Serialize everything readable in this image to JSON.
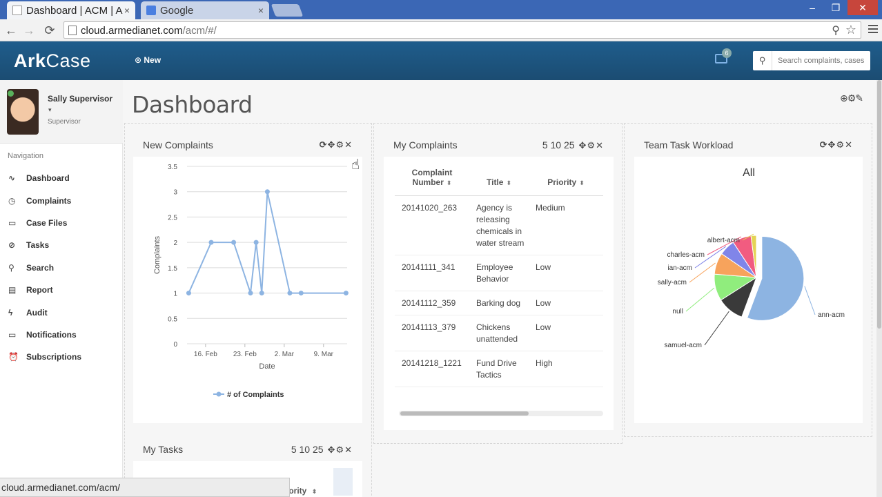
{
  "browser": {
    "tabs": [
      {
        "label": "Dashboard | ACM | A",
        "close": "×",
        "active": true
      },
      {
        "label": "Google",
        "close": "×",
        "active": false
      }
    ],
    "url_main": "cloud.armedianet.com",
    "url_path": "/acm/#/",
    "status_url": "cloud.armedianet.com/acm/",
    "window_controls": {
      "minimize": "–",
      "maximize": "❐",
      "close": "✕"
    }
  },
  "header": {
    "logo_a": "Ark",
    "logo_b": "Case",
    "new_label": "New",
    "notification_count": "6",
    "search_placeholder": "Search complaints, cases"
  },
  "user": {
    "name": "Sally Supervisor",
    "role": "Supervisor",
    "caret": "▾"
  },
  "navigation": {
    "header": "Navigation",
    "items": [
      {
        "icon": "chart-line-icon",
        "glyph": "∿",
        "label": "Dashboard"
      },
      {
        "icon": "clock-icon",
        "glyph": "◷",
        "label": "Complaints"
      },
      {
        "icon": "folder-icon",
        "glyph": "▭",
        "label": "Case Files"
      },
      {
        "icon": "check-circle-icon",
        "glyph": "⊘",
        "label": "Tasks"
      },
      {
        "icon": "search-icon",
        "glyph": "⚲",
        "label": "Search"
      },
      {
        "icon": "bar-chart-icon",
        "glyph": "▤",
        "label": "Report"
      },
      {
        "icon": "bolt-icon",
        "glyph": "ϟ",
        "label": "Audit"
      },
      {
        "icon": "comment-icon",
        "glyph": "▭",
        "label": "Notifications"
      },
      {
        "icon": "alarm-icon",
        "glyph": "⏰",
        "label": "Subscriptions"
      }
    ]
  },
  "page": {
    "title": "Dashboard",
    "tools": "⊕⚙✎"
  },
  "widgets": {
    "new_complaints": {
      "title": "New Complaints",
      "tools": "⟳✥⚙✕"
    },
    "my_complaints": {
      "title": "My Complaints",
      "pager": "5 10 25",
      "tools": "✥⚙✕",
      "columns": [
        "Complaint Number",
        "Title",
        "Priority"
      ],
      "rows": [
        {
          "number": "20141020_263",
          "title": "Agency is releasing chemicals in water stream",
          "priority": "Medium"
        },
        {
          "number": "20141111_341",
          "title": "Employee Behavior",
          "priority": "Low"
        },
        {
          "number": "20141112_359",
          "title": "Barking dog",
          "priority": "Low"
        },
        {
          "number": "20141113_379",
          "title": "Chickens unattended",
          "priority": "Low"
        },
        {
          "number": "20141218_1221",
          "title": "Fund Drive Tactics",
          "priority": "High"
        }
      ]
    },
    "team_task_workload": {
      "title": "Team Task Workload",
      "tools": "⟳✥⚙✕"
    },
    "my_tasks": {
      "title": "My Tasks",
      "pager": "5 10 25",
      "tools": "✥⚙✕",
      "partial_header": "iority"
    }
  },
  "chart_data": [
    {
      "type": "line",
      "xlabel": "Date",
      "ylabel": "Complaints",
      "ylim": [
        0,
        3.5
      ],
      "yticks": [
        "0",
        "0.5",
        "1",
        "1.5",
        "2",
        "2.5",
        "3",
        "3.5"
      ],
      "xticks": [
        "16. Feb",
        "23. Feb",
        "2. Mar",
        "9. Mar"
      ],
      "series": [
        {
          "name": "# of Complaints",
          "color": "#8db4e2",
          "x": [
            "2015-02-13",
            "2015-02-17",
            "2015-02-21",
            "2015-02-24",
            "2015-02-25",
            "2015-02-26",
            "2015-02-27",
            "2015-03-03",
            "2015-03-05",
            "2015-03-13"
          ],
          "y": [
            1,
            2,
            2,
            1,
            2,
            1,
            3,
            1,
            1,
            1
          ]
        }
      ],
      "legend": "bottom"
    },
    {
      "type": "pie",
      "title": "All",
      "slices": [
        {
          "label": "ann-acm",
          "value": 54,
          "color": "#8db4e2"
        },
        {
          "label": "samuel-acm",
          "value": 10,
          "color": "#3a3a3a"
        },
        {
          "label": "null",
          "value": 10,
          "color": "#90ed7d"
        },
        {
          "label": "sally-acm",
          "value": 8,
          "color": "#f7a35c"
        },
        {
          "label": "ian-acm",
          "value": 6,
          "color": "#8085e9"
        },
        {
          "label": "charles-acm",
          "value": 7,
          "color": "#f15c80"
        },
        {
          "label": "albert-acm",
          "value": 2,
          "color": "#e4d354"
        }
      ]
    }
  ]
}
